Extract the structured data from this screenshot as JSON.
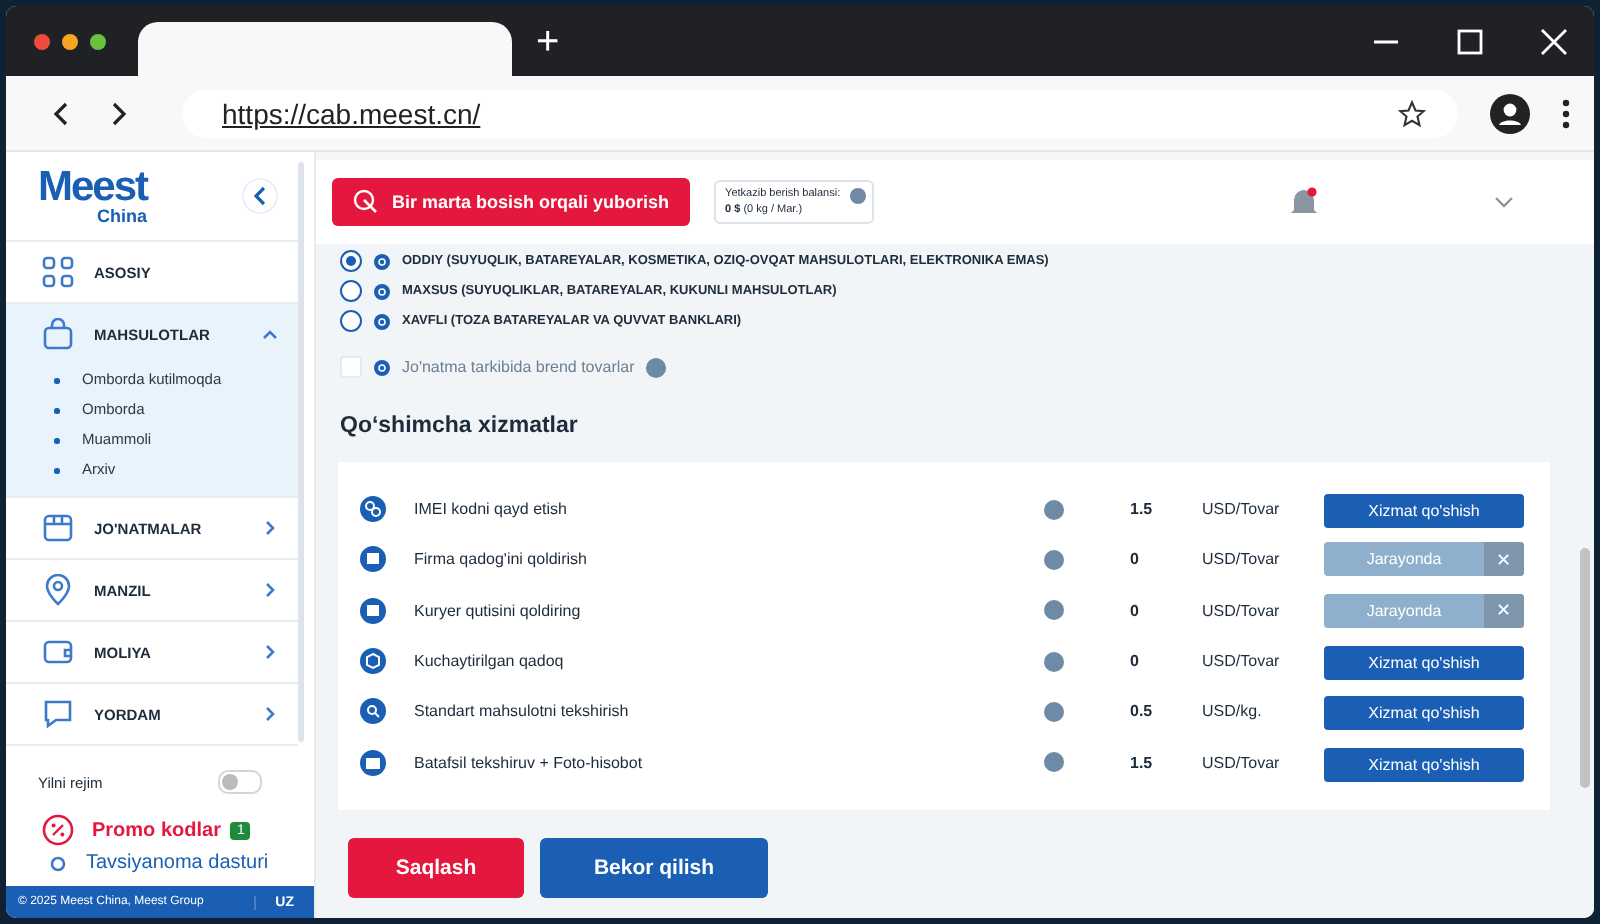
{
  "browser": {
    "url": "https://cab.meest.cn/",
    "new_tab": "+"
  },
  "sidebar": {
    "logo": "Meest",
    "logo_sub": "China",
    "items": [
      {
        "label": "ASOSIY",
        "kind": "link",
        "expanded": false
      },
      {
        "label": "MAHSULOTLAR",
        "kind": "group",
        "expanded": true,
        "children": [
          {
            "label": "Omborda kutilmoqda"
          },
          {
            "label": "Omborda"
          },
          {
            "label": "Muammoli"
          },
          {
            "label": "Arxiv"
          }
        ]
      },
      {
        "label": "JO'NATMALAR",
        "kind": "group",
        "expanded": false
      },
      {
        "label": "MANZIL",
        "kind": "group",
        "expanded": false
      },
      {
        "label": "MOLIYA",
        "kind": "group",
        "expanded": false
      },
      {
        "label": "YORDAM",
        "kind": "group",
        "expanded": false
      }
    ],
    "night_mode": {
      "label": "Yilni rejim",
      "on": false
    },
    "promo": {
      "label": "Promo kodlar",
      "badge": "1"
    },
    "referral": {
      "label": "Tavsiyanoma dasturi"
    },
    "footer": {
      "copyright": "© 2025 Meest China, Meest Group",
      "language": "UZ"
    }
  },
  "header": {
    "send_button": "Bir marta bosish orqali yuborish",
    "balance": {
      "label": "Yetkazib berish balansi:",
      "amount": "0 $",
      "detail": "(0 kg / Mar.)"
    },
    "notification": true
  },
  "cargo_types": [
    {
      "label": "ODDIY (SUYUQLIK, BATAREYALAR, KOSMETIKA, OZIQ-OVQAT MAHSULOTLARI, ELEKTRONIKA EMAS)",
      "selected": true
    },
    {
      "label": "MAXSUS (SUYUQLIKLAR, BATAREYALAR, KUKUNLI MAHSULOTLAR)",
      "selected": false
    },
    {
      "label": "XAVFLI (TOZA BATAREYALAR VA QUVVAT BANKLARI)",
      "selected": false
    }
  ],
  "brand_goods": {
    "label": "Jo'natma tarkibida brend tovarlar",
    "checked": false
  },
  "services_title": "Qo‘shimcha xizmatlar",
  "services": [
    {
      "name": "IMEI kodni qayd etish",
      "price": "1.5",
      "unit": "USD/Tovar",
      "kind": "add",
      "button": "Xizmat qo'shish"
    },
    {
      "name": "Firma qadog'ini qoldirish",
      "price": "0",
      "unit": "USD/Tovar",
      "kind": "pending",
      "button": "Jarayonda",
      "remove": "✕"
    },
    {
      "name": "Kuryer qutisini qoldiring",
      "price": "0",
      "unit": "USD/Tovar",
      "kind": "pending",
      "button": "Jarayonda",
      "remove": "✕"
    },
    {
      "name": "Kuchaytirilgan qadoq",
      "price": "0",
      "unit": "USD/Tovar",
      "kind": "add",
      "button": "Xizmat qo'shish"
    },
    {
      "name": "Standart mahsulotni tekshirish",
      "price": "0.5",
      "unit": "USD/kg.",
      "kind": "add",
      "button": "Xizmat qo'shish"
    },
    {
      "name": "Batafsil tekshiruv + Foto-hisobot",
      "price": "1.5",
      "unit": "USD/Tovar",
      "kind": "add",
      "button": "Xizmat qo'shish"
    }
  ],
  "actions": {
    "save": "Saqlash",
    "cancel": "Bekor qilish"
  }
}
